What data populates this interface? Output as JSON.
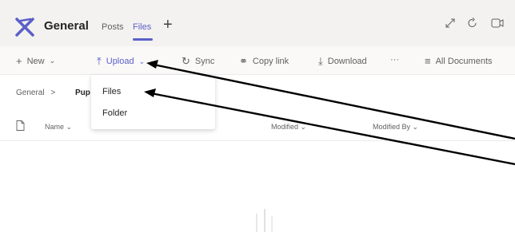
{
  "header": {
    "title": "General",
    "tabs": [
      {
        "label": "Posts"
      },
      {
        "label": "Files"
      }
    ],
    "add_tab": "+"
  },
  "commands": {
    "new": "New",
    "upload": "Upload",
    "sync": "Sync",
    "copy_link": "Copy link",
    "download": "Download",
    "more": "···",
    "all_documents": "All Documents"
  },
  "breadcrumb": {
    "root": "General",
    "current": "Pup"
  },
  "columns": {
    "name": "Name",
    "modified": "Modified",
    "modified_by": "Modified By"
  },
  "upload_menu": {
    "items": [
      "Files",
      "Folder"
    ]
  },
  "colors": {
    "accent": "#5b5fc7",
    "header_bg": "#f3f2f1",
    "arrow": "#000000"
  },
  "icons": [
    "teams-channel-icon",
    "expand-icon",
    "refresh-icon",
    "meeting-icon",
    "plus-icon",
    "chevron-down-icon",
    "upload-icon",
    "sync-icon",
    "link-icon",
    "download-icon",
    "filter-icon",
    "document-icon"
  ]
}
